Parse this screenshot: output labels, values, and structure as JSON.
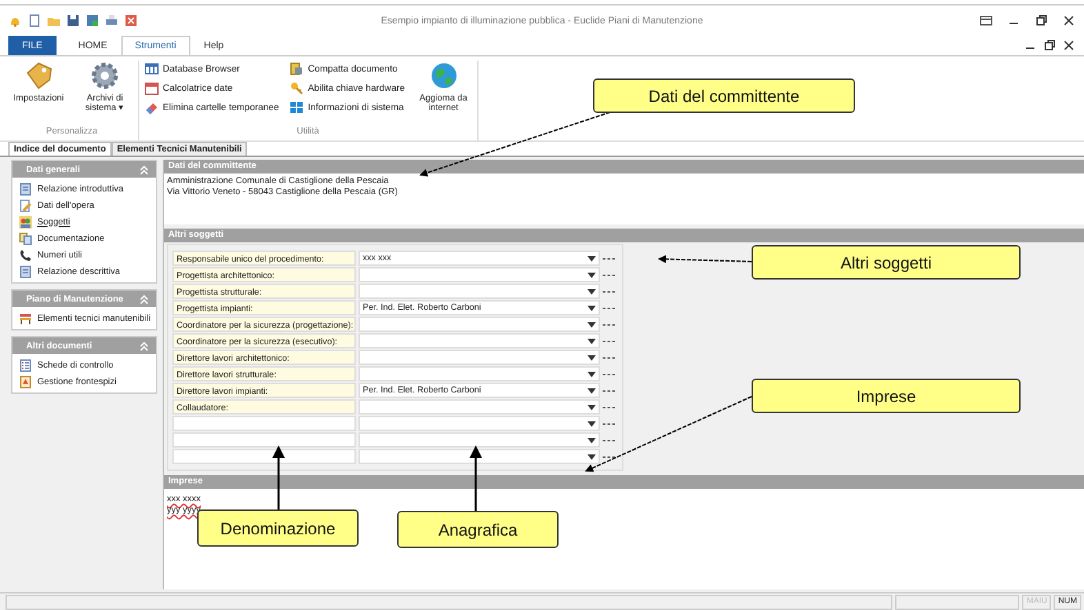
{
  "window": {
    "title": "Esempio impianto di illuminazione pubblica - Euclide Piani di Manutenzione"
  },
  "ribbon_tabs": [
    {
      "label": "FILE",
      "kind": "file",
      "selected": false
    },
    {
      "label": "HOME",
      "kind": "tab",
      "selected": false
    },
    {
      "label": "Strumenti",
      "kind": "tab",
      "selected": true
    },
    {
      "label": "Help",
      "kind": "tab",
      "selected": false
    }
  ],
  "ribbon_groups": [
    {
      "label": "Personalizza",
      "items": [
        {
          "label": "Impostazioni",
          "kind": "large"
        },
        {
          "label": "Archivi di sistema ▾",
          "kind": "large"
        }
      ]
    },
    {
      "label": "Utilità",
      "items": [
        {
          "label": "Database Browser",
          "kind": "small"
        },
        {
          "label": "Calcolatrice date",
          "kind": "small"
        },
        {
          "label": "Elimina cartelle temporanee",
          "kind": "small"
        },
        {
          "label": "Compatta documento",
          "kind": "small"
        },
        {
          "label": "Abilita chiave hardware",
          "kind": "small"
        },
        {
          "label": "Informazioni di sistema",
          "kind": "small"
        },
        {
          "label": "Aggioma da internet",
          "kind": "large"
        }
      ]
    }
  ],
  "document_tabs": [
    {
      "label": "Indice del documento",
      "selected": true
    },
    {
      "label": "Elementi Tecnici Manutenibili",
      "selected": false
    }
  ],
  "sidebar": {
    "sections": [
      {
        "title": "Dati generali",
        "items": [
          {
            "label": "Relazione introduttiva",
            "selected": false
          },
          {
            "label": "Dati dell'opera",
            "selected": false
          },
          {
            "label": "Soggetti",
            "selected": true
          },
          {
            "label": "Documentazione",
            "selected": false
          },
          {
            "label": "Numeri utili",
            "selected": false
          },
          {
            "label": "Relazione descrittiva",
            "selected": false
          }
        ]
      },
      {
        "title": "Piano di Manutenzione",
        "items": [
          {
            "label": "Elementi tecnici manutenibili",
            "selected": false
          }
        ]
      },
      {
        "title": "Altri documenti",
        "items": [
          {
            "label": "Schede di controllo",
            "selected": false
          },
          {
            "label": "Gestione frontespizi",
            "selected": false
          }
        ]
      }
    ]
  },
  "committente": {
    "title": "Dati del committente",
    "lines": [
      "Amministrazione Comunale di Castiglione della Pescaia",
      "Via Vittorio Veneto - 58043 Castiglione della Pescaia (GR)"
    ]
  },
  "altri_soggetti": {
    "title": "Altri soggetti",
    "rows": [
      {
        "label": "Responsabile unico del procedimento:",
        "value": "xxx xxx"
      },
      {
        "label": "Progettista architettonico:"
      },
      {
        "label": "Progettista strutturale:"
      },
      {
        "label": "Progettista impianti:",
        "value": "Per. Ind. Elet. Roberto Carboni"
      },
      {
        "label": "Coordinatore per la sicurezza (progettazione):"
      },
      {
        "label": "Coordinatore per la sicurezza (esecutivo):"
      },
      {
        "label": "Direttore lavori architettonico:"
      },
      {
        "label": "Direttore lavori strutturale:"
      },
      {
        "label": "Direttore lavori impianti:",
        "value": "Per. Ind. Elet. Roberto Carboni"
      },
      {
        "label": "Collaudatore:"
      },
      {},
      {},
      {}
    ]
  },
  "imprese": {
    "title": "Imprese",
    "lines": [
      "xxx xxxx",
      "yyy yyyy"
    ]
  },
  "callouts": [
    {
      "label": "Dati del committente"
    },
    {
      "label": "Altri soggetti"
    },
    {
      "label": "Imprese"
    },
    {
      "label": "Denominazione"
    },
    {
      "label": "Anagrafica"
    }
  ],
  "status_bar": [
    {
      "label": "MAIU",
      "disabled": true
    },
    {
      "label": "NUM",
      "disabled": false
    }
  ]
}
